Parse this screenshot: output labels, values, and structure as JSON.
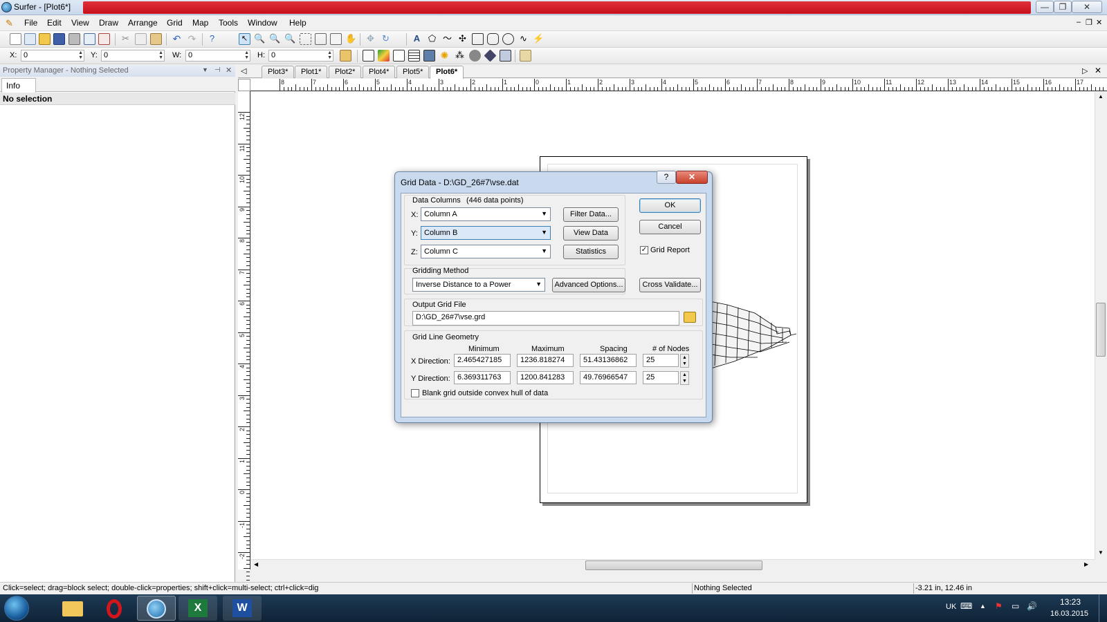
{
  "window": {
    "title": "Surfer - [Plot6*]"
  },
  "menu": [
    "File",
    "Edit",
    "View",
    "Draw",
    "Arrange",
    "Grid",
    "Map",
    "Tools",
    "Window",
    "Help"
  ],
  "coords": {
    "x_label": "X:",
    "x_value": "0",
    "y_label": "Y:",
    "y_value": "0",
    "w_label": "W:",
    "w_value": "0",
    "h_label": "H:",
    "h_value": "0"
  },
  "property_manager": {
    "title": "Property Manager - Nothing Selected",
    "tab": "Info",
    "no_selection": "No selection"
  },
  "doc_tabs": [
    "Plot3*",
    "Plot1*",
    "Plot2*",
    "Plot4*",
    "Plot5*",
    "Plot6*"
  ],
  "ruler": {
    "h_ticks": [
      "8",
      "7",
      "6",
      "5",
      "4",
      "3",
      "2",
      "1",
      "0",
      "1",
      "2",
      "3",
      "4",
      "5",
      "6",
      "7",
      "8",
      "9",
      "10",
      "11",
      "12",
      "13",
      "14",
      "15",
      "16",
      "17"
    ],
    "v_ticks": [
      "12",
      "11",
      "10",
      "9",
      "8",
      "7",
      "6",
      "5",
      "4",
      "3",
      "2",
      "1",
      "0",
      "-1",
      "-2"
    ]
  },
  "dialog": {
    "title": "Grid Data - D:\\GD_26#7\\vse.dat",
    "help_btn": "?",
    "close_btn": "✕",
    "data_columns_label": "Data Columns",
    "data_points": "(446 data points)",
    "x_label": "X:",
    "x_value": "Column A",
    "y_label": "Y:",
    "y_value": "Column B",
    "z_label": "Z:",
    "z_value": "Column C",
    "filter_btn": "Filter Data...",
    "view_btn": "View Data",
    "stats_btn": "Statistics",
    "ok_btn": "OK",
    "cancel_btn": "Cancel",
    "grid_report_label": "Grid Report",
    "grid_report_checked": true,
    "gridding_method_label": "Gridding Method",
    "gridding_method": "Inverse Distance to a Power",
    "advanced_btn": "Advanced Options...",
    "cross_validate_btn": "Cross Validate...",
    "output_label": "Output Grid File",
    "output_path": "D:\\GD_26#7\\vse.grd",
    "geometry_label": "Grid Line Geometry",
    "col_min": "Minimum",
    "col_max": "Maximum",
    "col_spacing": "Spacing",
    "col_nodes": "# of Nodes",
    "x_dir_label": "X Direction:",
    "x_min": "2.465427185",
    "x_max": "1236.818274",
    "x_spacing": "51.43136862",
    "x_nodes": "25",
    "y_dir_label": "Y Direction:",
    "y_min": "6.369311763",
    "y_max": "1200.841283",
    "y_spacing": "49.76966547",
    "y_nodes": "25",
    "blank_label": "Blank grid outside convex hull of data"
  },
  "status": {
    "hint": "Click=select; drag=block select; double-click=properties; shift+click=multi-select; ctrl+click=dig",
    "selection": "Nothing Selected",
    "position": "-3.21 in, 12.46 in"
  },
  "taskbar": {
    "lang": "UK",
    "time": "13:23",
    "date": "16.03.2015"
  }
}
